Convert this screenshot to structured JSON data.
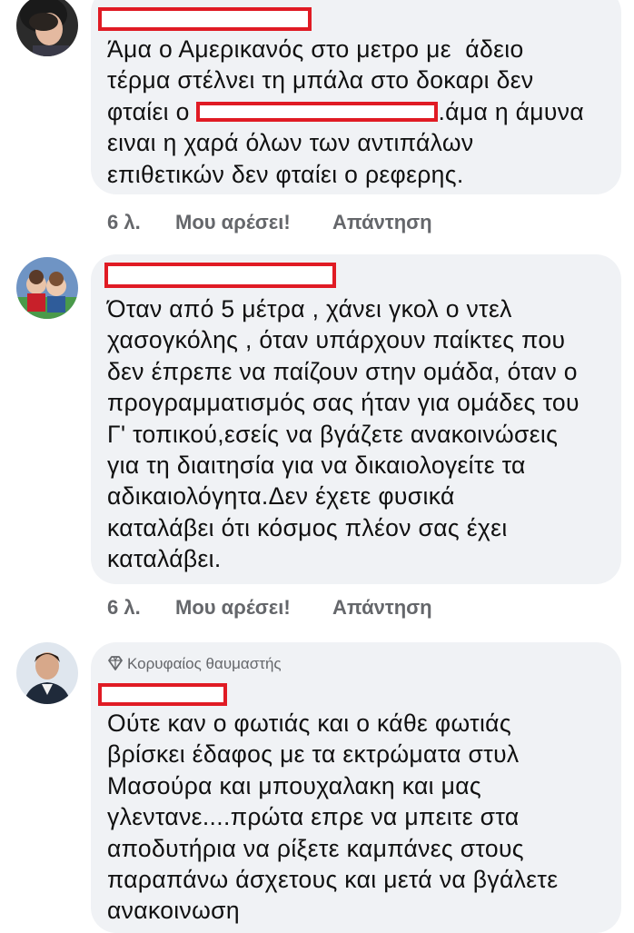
{
  "comments": [
    {
      "text_before": "Άμα ο Αμερικανός στο μετρο με  άδειο\nτέρμα στέλνει τη μπάλα στο δοκαρι δεν\nφταίει ο ",
      "text_after": ".άμα η άμυνα\nειναι η χαρά όλων των αντιπάλων\nεπιθετικών δεν φταίει ο ρεφερης.",
      "time": "6 λ.",
      "like": "Μου αρέσει!",
      "reply": "Απάντηση"
    },
    {
      "text": "Όταν από 5 μέτρα , χάνει γκολ ο ντελ\nχασογκόλης , όταν υπάρχουν παίκτες που\nδεν έπρεπε να παίζουν στην ομάδα, όταν ο\nπρογραμματισμός σας ήταν για ομάδες του\nΓ' τοπικού,εσείς να βγάζετε ανακοινώσεις\nγια τη διαιτησία για να δικαιολογείτε τα\nαδικαιολόγητα.Δεν έχετε φυσικά\nκαταλάβει ότι κόσμος πλέον σας έχει\nκαταλάβει.",
      "time": "6 λ.",
      "like": "Μου αρέσει!",
      "reply": "Απάντηση"
    },
    {
      "badge": "Κορυφαίος θαυμαστής",
      "text": "Ούτε καν ο φωτιάς και ο κάθε φωτιάς\nβρίσκει έδαφος με τα εκτρώματα στυλ\nΜασούρα και μπουχαλακη και μας\nγλεντανε....πρώτα επρε να μπειτε στα\nαποδυτήρια να ρίξετε καμπάνες στους\nπαραπάνω άσχετους και μετά να βγάλετε\nανακοινωση"
    }
  ],
  "colors": {
    "bubble": "#f0f2f5",
    "redaction": "#e01b24",
    "meta_text": "#65676b"
  },
  "icons": {
    "badge": "diamond-icon"
  }
}
